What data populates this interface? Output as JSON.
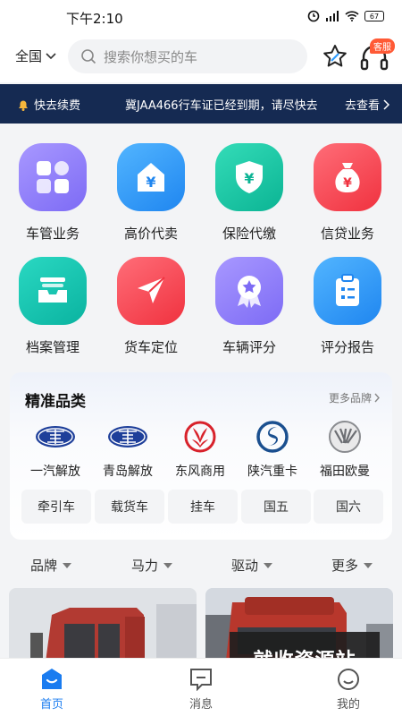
{
  "status": {
    "time": "下午2:10",
    "battery": "67"
  },
  "header": {
    "region": "全国",
    "search_placeholder": "搜索你想买的车",
    "service_badge": "客服"
  },
  "notice": {
    "label": "快去续费",
    "text": "冀JAA466行车证已经到期，请尽快去",
    "action": "去查看"
  },
  "services": [
    {
      "label": "车管业务",
      "icon": "grid-icon",
      "color": "#8f7dff"
    },
    {
      "label": "高价代卖",
      "icon": "house-yen-icon",
      "color": "#2f9dff"
    },
    {
      "label": "保险代缴",
      "icon": "shield-yen-icon",
      "color": "#14c5a4"
    },
    {
      "label": "信贷业务",
      "icon": "money-bag-icon",
      "color": "#ff4a58"
    },
    {
      "label": "档案管理",
      "icon": "archive-tray-icon",
      "color": "#12c4b0"
    },
    {
      "label": "货车定位",
      "icon": "location-arrow-icon",
      "color": "#ff4a58"
    },
    {
      "label": "车辆评分",
      "icon": "award-badge-icon",
      "color": "#8f7dff"
    },
    {
      "label": "评分报告",
      "icon": "clipboard-icon",
      "color": "#2f9dff"
    }
  ],
  "category": {
    "title": "精准品类",
    "more": "更多品牌",
    "brands": [
      {
        "label": "一汽解放",
        "icon": "faw-logo-icon"
      },
      {
        "label": "青岛解放",
        "icon": "faw-logo-icon"
      },
      {
        "label": "东风商用",
        "icon": "dongfeng-logo-icon"
      },
      {
        "label": "陕汽重卡",
        "icon": "shacman-logo-icon"
      },
      {
        "label": "福田欧曼",
        "icon": "foton-logo-icon"
      }
    ],
    "types": [
      "牵引车",
      "载货车",
      "挂车",
      "国五",
      "国六"
    ]
  },
  "filters": [
    "品牌",
    "马力",
    "驱动",
    "更多"
  ],
  "watermark": "就收资源站",
  "tabs": [
    {
      "label": "首页",
      "icon": "home-icon",
      "active": true
    },
    {
      "label": "消息",
      "icon": "message-icon"
    },
    {
      "label": "我的",
      "icon": "profile-icon"
    }
  ],
  "colors": {
    "accent": "#1a7cf0",
    "notice_bg": "#152a52",
    "badge": "#ff5a36"
  }
}
